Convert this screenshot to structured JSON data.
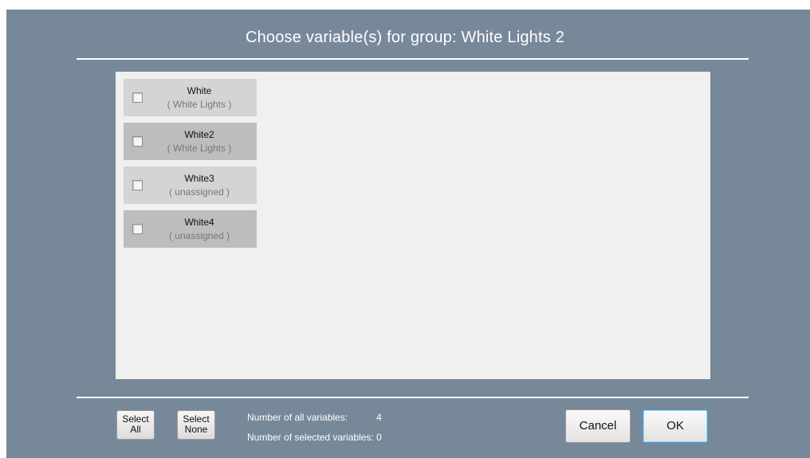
{
  "dialog": {
    "title": "Choose variable(s) for group: White Lights 2"
  },
  "variables": [
    {
      "name": "White",
      "group": "( White Lights )",
      "checked": false
    },
    {
      "name": "White2",
      "group": "( White Lights )",
      "checked": false
    },
    {
      "name": "White3",
      "group": "( unassigned )",
      "checked": false
    },
    {
      "name": "White4",
      "group": "( unassigned )",
      "checked": false
    }
  ],
  "footer": {
    "select_all": {
      "line1": "Select",
      "line2": "All"
    },
    "select_none": {
      "line1": "Select",
      "line2": "None"
    },
    "all_variables_label": "Number of all variables:",
    "all_variables_value": "4",
    "selected_variables_label": "Number of selected variables:",
    "selected_variables_value": "0",
    "cancel_label": "Cancel",
    "ok_label": "OK"
  },
  "colors": {
    "dialog_bg": "#778899",
    "list_bg": "#f0f0f0",
    "item_light": "#d4d4d4",
    "item_dark": "#bdbdbd",
    "ok_focus_border": "#3c9ee5"
  }
}
